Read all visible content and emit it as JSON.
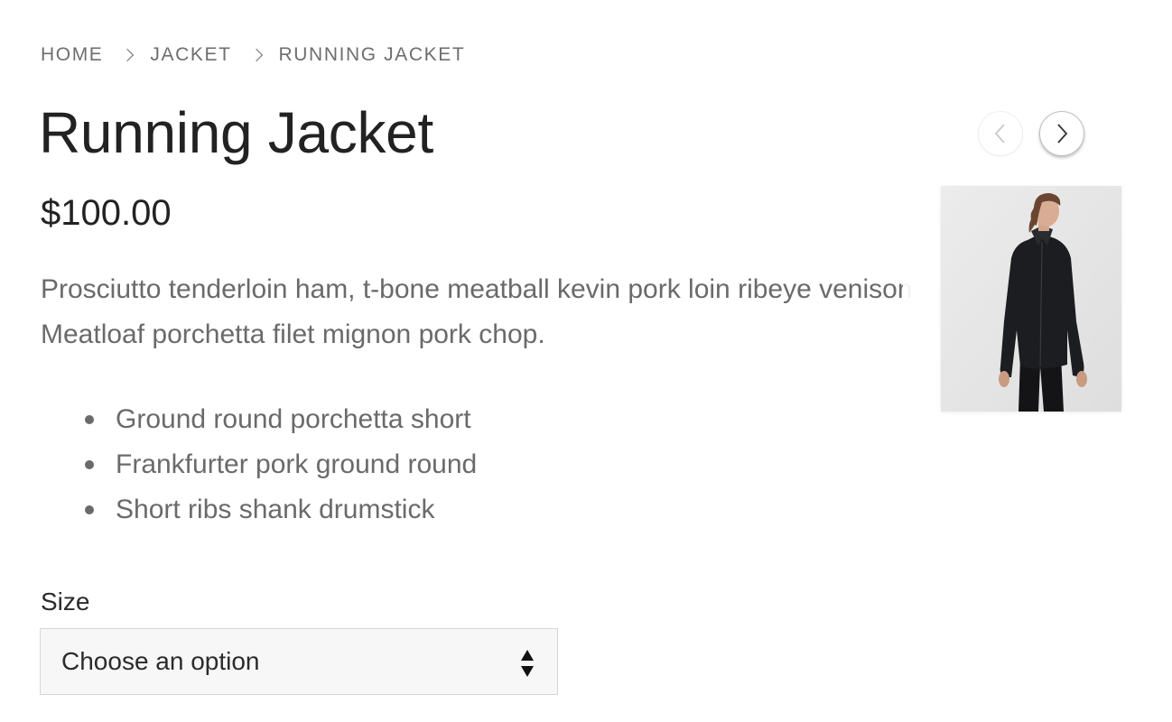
{
  "breadcrumb": {
    "items": [
      "HOME",
      "JACKET",
      "RUNNING JACKET"
    ]
  },
  "product": {
    "title": "Running Jacket",
    "price": "$100.00",
    "description_line1": "Prosciutto tenderloin ham, t-bone meatball kevin pork loin ribeye venison",
    "description_line2": "Meatloaf porchetta filet mignon pork chop.",
    "features": [
      "Ground round porchetta short",
      "Frankfurter pork ground round",
      "Short ribs shank drumstick"
    ]
  },
  "variation": {
    "size_label": "Size",
    "size_selected": "Choose an option"
  },
  "navigation": {
    "prev_icon": "chevron-left-icon",
    "next_icon": "chevron-right-icon"
  },
  "thumbnail": {
    "icon": "product-thumbnail-image"
  }
}
